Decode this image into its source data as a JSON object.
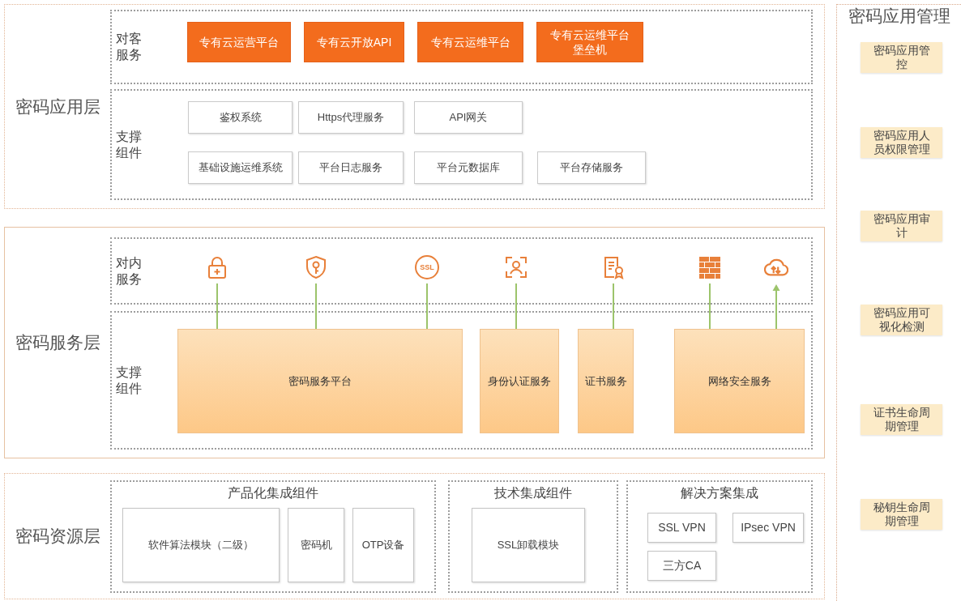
{
  "application_layer": {
    "title": "密码应用层",
    "customer_services": {
      "label": "对客服务",
      "items": [
        "专有云运营平台",
        "专有云开放API",
        "专有云运维平台",
        "专有云运维平台堡垒机"
      ]
    },
    "support_components": {
      "label": "支撑组件",
      "rows": [
        [
          "鉴权系统",
          "Https代理服务",
          "API网关"
        ],
        [
          "基础设施运维系统",
          "平台日志服务",
          "平台元数据库",
          "平台存储服务"
        ]
      ]
    }
  },
  "service_layer": {
    "title": "密码服务层",
    "internal_services": {
      "label": "对内服务",
      "badge": "SSL"
    },
    "support_components": {
      "label": "支撑组件",
      "items": [
        "密码服务平台",
        "身份认证服务",
        "证书服务",
        "网络安全服务"
      ]
    }
  },
  "resource_layer": {
    "title": "密码资源层",
    "groups": [
      {
        "title": "产品化集成组件",
        "kind": "row",
        "items": [
          "软件算法模块（二级）",
          "密码机",
          "OTP设备"
        ]
      },
      {
        "title": "技术集成组件",
        "kind": "row",
        "items": [
          "SSL卸载模块"
        ]
      },
      {
        "title": "解决方案集成",
        "kind": "grid",
        "items": [
          "SSL VPN",
          "IPsec VPN",
          "三方CA"
        ]
      }
    ]
  },
  "management": {
    "title": "密码应用管理",
    "items": [
      "密码应用管控",
      "密码应用人员权限管理",
      "密码应用审计",
      "密码应用可视化检测",
      "证书生命周期管理",
      "秘钥生命周期管理"
    ]
  }
}
